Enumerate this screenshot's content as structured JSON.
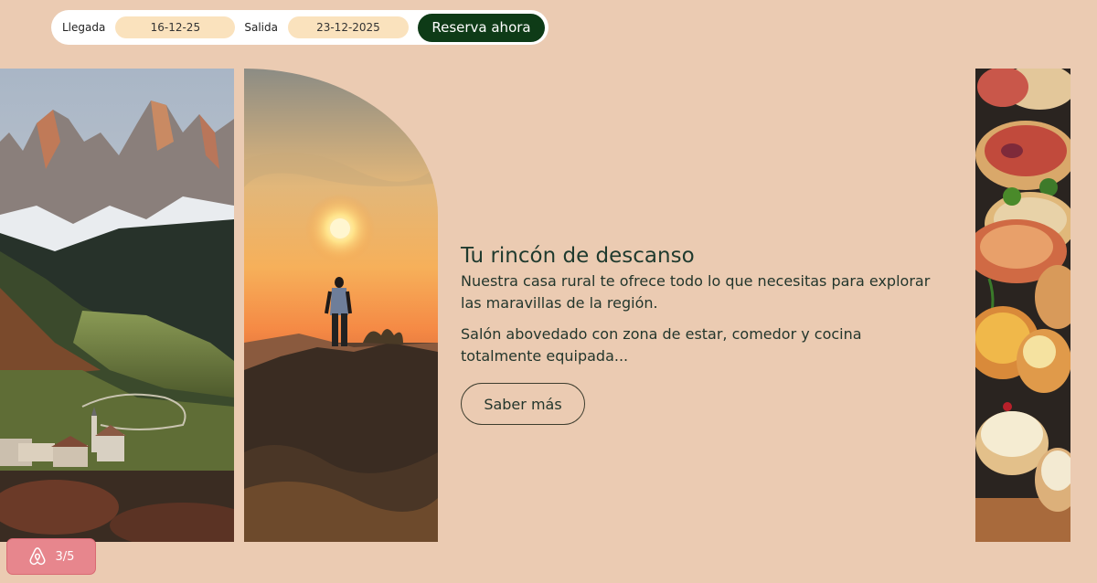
{
  "booking": {
    "arrival_label": "Llegada",
    "arrival_value": "16-12-25",
    "departure_label": "Salida",
    "departure_value": "23-12-2025",
    "book_label": "Reserva ahora"
  },
  "gallery": {
    "images": [
      {
        "name": "mountain-village-photo",
        "icon": "photo-image"
      },
      {
        "name": "sunset-hiker-photo",
        "icon": "photo-image"
      },
      {
        "name": "tapas-food-photo",
        "icon": "photo-image"
      }
    ]
  },
  "content": {
    "title": "Tu rincón de descanso",
    "description": "Nuestra casa rural te ofrece todo lo que necesitas para explorar las maravillas de la región.",
    "detail": "Salón abovedado con zona de estar, comedor y cocina totalmente equipada...",
    "more_label": "Saber más"
  },
  "badge": {
    "count": "3/5",
    "icon": "airbnb-icon"
  },
  "colors": {
    "background": "#ebcbb2",
    "accent_dark_green": "#0e3b17",
    "field_bg": "#fae2bd",
    "badge_bg": "#e7868d"
  }
}
